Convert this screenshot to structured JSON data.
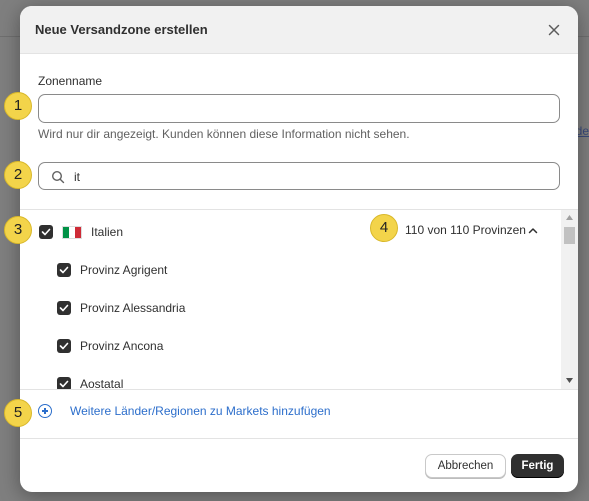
{
  "modal": {
    "title": "Neue Versandzone erstellen"
  },
  "zone_name": {
    "label": "Zonenname",
    "value": "",
    "help": "Wird nur dir angezeigt. Kunden können diese Information nicht sehen."
  },
  "search": {
    "value": "it"
  },
  "country": {
    "name": "Italien",
    "checked": true,
    "count_label": "110 von 110 Provinzen",
    "flag_colors": [
      "#009246",
      "#ffffff",
      "#ce2b37"
    ]
  },
  "provinces": [
    {
      "name": "Provinz Agrigent",
      "checked": true
    },
    {
      "name": "Provinz Alessandria",
      "checked": true
    },
    {
      "name": "Provinz Ancona",
      "checked": true
    },
    {
      "name": "Aostatal",
      "checked": true
    }
  ],
  "add_link": "Weitere Länder/Regionen zu Markets hinzufügen",
  "footer": {
    "cancel_label": "Abbrechen",
    "done_label": "Fertig"
  },
  "annotations": [
    "1",
    "2",
    "3",
    "4",
    "5"
  ],
  "colors": {
    "accent": "#2c6ecb",
    "primary_button": "#303030",
    "badge": "#f3d44a"
  }
}
